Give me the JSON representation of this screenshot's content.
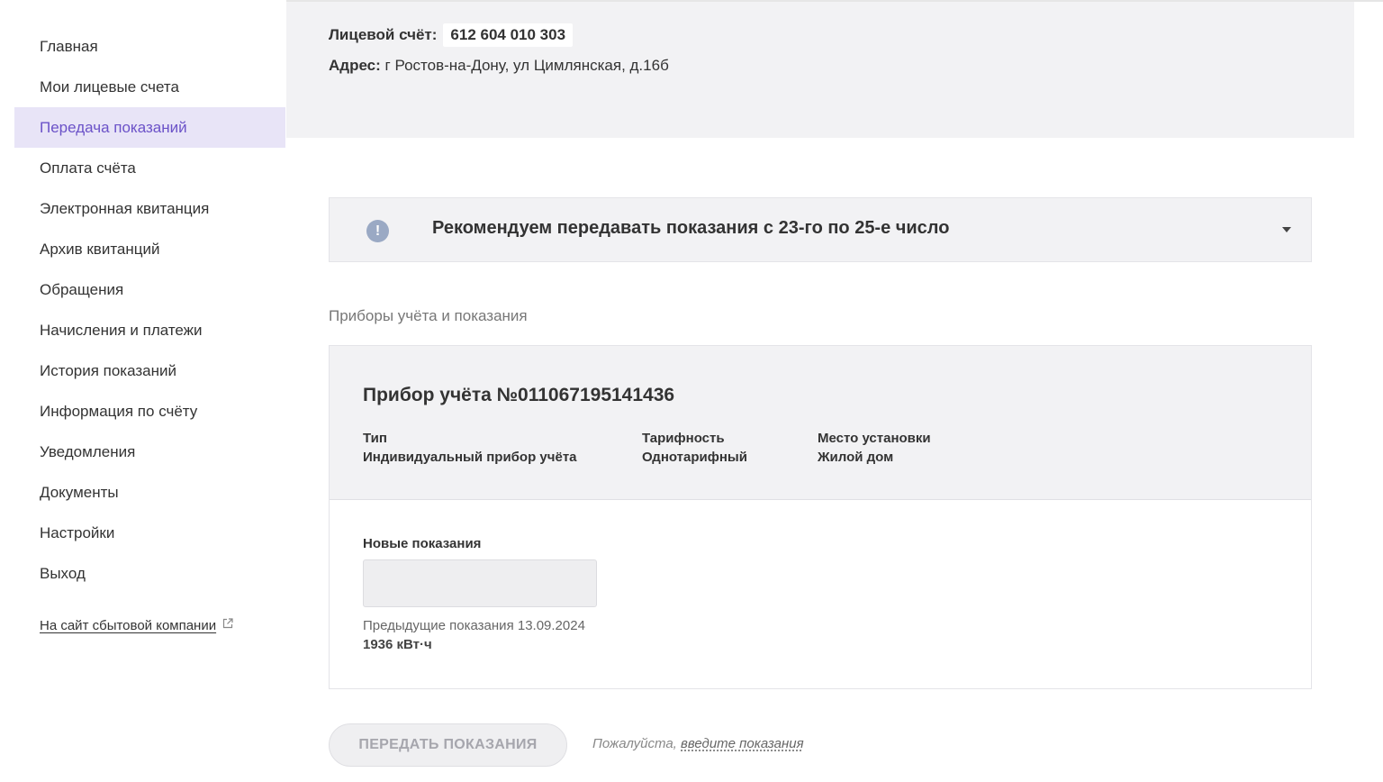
{
  "sidebar": {
    "items": [
      {
        "label": "Главная"
      },
      {
        "label": "Мои лицевые счета"
      },
      {
        "label": "Передача показаний"
      },
      {
        "label": "Оплата счёта"
      },
      {
        "label": "Электронная квитанция"
      },
      {
        "label": "Архив квитанций"
      },
      {
        "label": "Обращения"
      },
      {
        "label": "Начисления и платежи"
      },
      {
        "label": "История показаний"
      },
      {
        "label": "Информация по счёту"
      },
      {
        "label": "Уведомления"
      },
      {
        "label": "Документы"
      },
      {
        "label": "Настройки"
      },
      {
        "label": "Выход"
      }
    ],
    "active_item": "Передача показаний",
    "external_link": "На сайт сбытовой компании",
    "external_link_icon": "external-link-icon"
  },
  "account": {
    "number_label": "Лицевой счёт:",
    "number_value": "612 604 010 303",
    "address_label": "Адрес:",
    "address_value": "г Ростов-на-Дону, ул Цимлянская, д.16б"
  },
  "notice": {
    "icon": "exclamation-circle-icon",
    "text": "Рекомендуем передавать показания с 23-го по 25-е число",
    "caret_icon": "caret-down-icon"
  },
  "meters_section": {
    "title": "Приборы учёта и показания"
  },
  "meter": {
    "title": "Прибор учёта №011067195141436",
    "type_label": "Тип",
    "type_value": "Индивидуальный прибор учёта",
    "tariff_label": "Тарифность",
    "tariff_value": "Однотарифный",
    "location_label": "Место установки",
    "location_value": "Жилой дом",
    "new_readings_label": "Новые показания",
    "new_readings_value": "",
    "previous_label": "Предыдущие показания 13.09.2024",
    "previous_value": "1936 кВт·ч"
  },
  "actions": {
    "submit_label": "ПЕРЕДАТЬ ПОКАЗАНИЯ",
    "hint_prefix": "Пожалуйста,",
    "hint_link": "введите показания"
  },
  "colors": {
    "accent": "#6b52c8",
    "active_bg": "#e8e4f7",
    "panel_bg": "#f2f2f4",
    "notice_icon": "#9aa9c4"
  }
}
